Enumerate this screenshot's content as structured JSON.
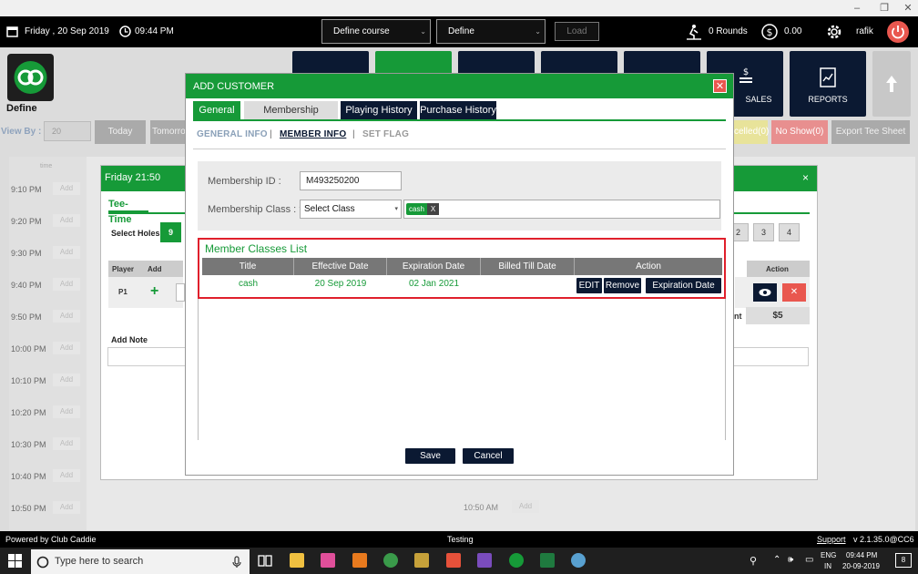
{
  "window": {
    "minimize": "–",
    "restore": "❐",
    "close": "✕"
  },
  "topbar": {
    "date": "Friday ,  20 Sep 2019",
    "time": "09:44 PM",
    "course_select": "Define course",
    "define_select": "Define",
    "load_label": "Load",
    "rounds": "0 Rounds",
    "balance": "0.00",
    "user": "rafik"
  },
  "brand": {
    "label": "Define"
  },
  "nav": {
    "sales_label": "SALES",
    "reports_label": "REPORTS"
  },
  "viewrow": {
    "view_by": "View By :",
    "view_value": "20",
    "today": "Today",
    "tomorrow": "Tomorro",
    "cancelled": "celled(0)",
    "no_show": "No Show(0)",
    "export": "Export Tee Sheet"
  },
  "schedule": {
    "left_header": "time",
    "add_label": "Add",
    "times": [
      "9:10 PM",
      "9:20 PM",
      "9:30 PM",
      "9:40 PM",
      "9:50 PM",
      "10:00 PM",
      "10:10 PM",
      "10:20 PM",
      "10:30 PM",
      "10:40 PM",
      "10:50 PM"
    ],
    "right_time": "10:50 AM"
  },
  "teetime": {
    "header": "Friday 21:50",
    "tab": "Tee-Time",
    "select_holes": "Select Holes",
    "holes_active": "9",
    "holes": [
      "2",
      "3",
      "4"
    ],
    "col_player": "Player",
    "col_add": "Add",
    "col_action": "Action",
    "row_player": "P1",
    "add_note": "Add Note",
    "nt": "nt",
    "price": "$5"
  },
  "modal": {
    "title": "ADD CUSTOMER",
    "close": "✕",
    "tabs": [
      "General",
      "Membership",
      "Playing History",
      "Purchase History"
    ],
    "subtabs": [
      "GENERAL INFO",
      "MEMBER INFO",
      "SET FLAG"
    ],
    "separator": "|",
    "membership_id_label": "Membership ID :",
    "membership_id_value": "M493250200",
    "membership_class_label": "Membership Class : ?",
    "class_select": "Select Class",
    "class_tag": "cash",
    "class_tag_remove": "X",
    "list_title": "Member Classes List",
    "columns": [
      "Title",
      "Effective Date",
      "Expiration Date",
      "Billed Till Date",
      "Action"
    ],
    "row": {
      "title": "cash",
      "effective": "20 Sep 2019",
      "expiration": "02 Jan 2021",
      "billed": ""
    },
    "actions": [
      "EDIT",
      "Remove",
      "Expiration Date"
    ],
    "save": "Save",
    "cancel": "Cancel"
  },
  "statusbar": {
    "powered": "Powered by Club Caddie",
    "env": "Testing",
    "support": "Support",
    "version": "v 2.1.35.0@CC6"
  },
  "taskbar": {
    "search_placeholder": "Type here to search",
    "lang1": "ENG",
    "lang2": "IN",
    "clock_time": "09:44 PM",
    "clock_date": "20-09-2019",
    "notif": "8"
  }
}
